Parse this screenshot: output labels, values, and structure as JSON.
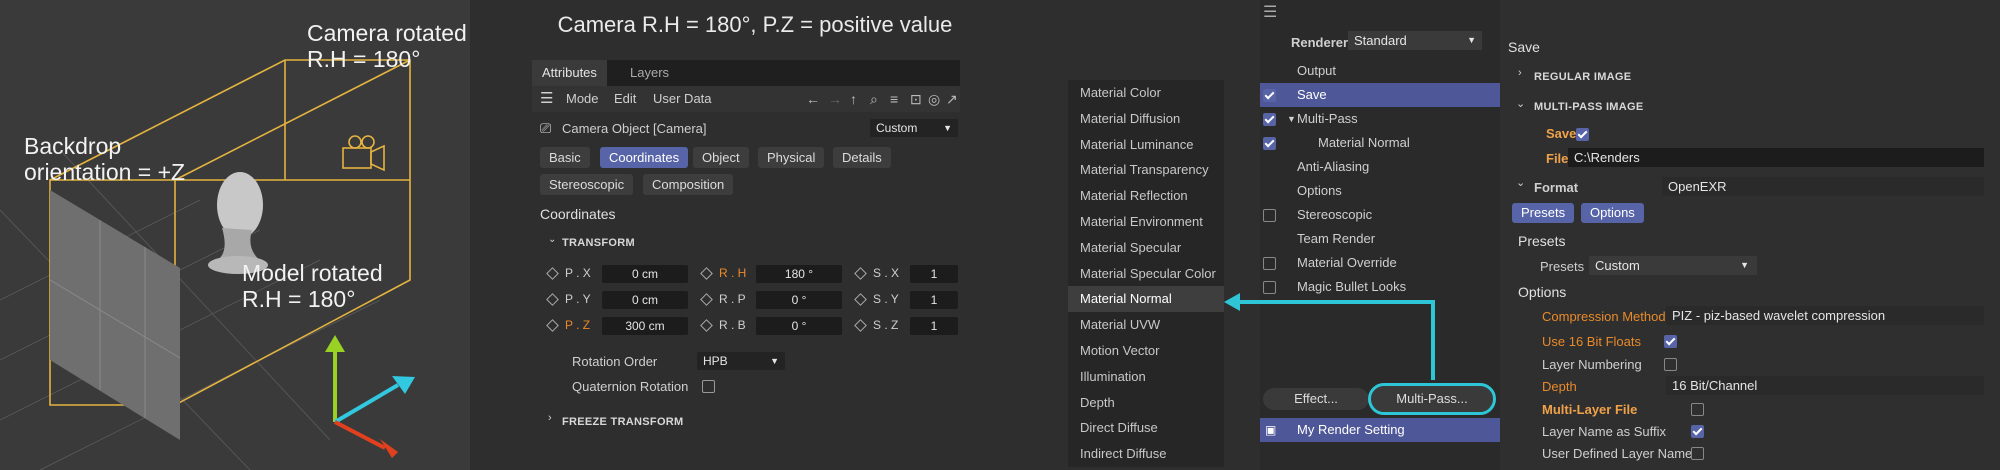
{
  "scene": {
    "camera_label_line1": "Camera rotated",
    "camera_label_line2": "R.H = 180°",
    "backdrop_label_line1": "Backdrop",
    "backdrop_label_line2": "orientation = +Z",
    "model_label_line1": "Model rotated",
    "model_label_line2": "R.H = 180°",
    "colors": {
      "wire": "#e4b340",
      "axis_y": "#9ad125",
      "axis_z": "#32c8e0",
      "axis_x": "#e0401e"
    }
  },
  "attributes": {
    "header": "Camera R.H = 180°, P.Z = positive value",
    "tabs": [
      "Attributes",
      "Layers"
    ],
    "menu": [
      "Mode",
      "Edit",
      "User Data"
    ],
    "object_name": "Camera Object [Camera]",
    "object_dropdown": "Custom",
    "property_tabs": [
      "Basic",
      "Coordinates",
      "Object",
      "Physical",
      "Details",
      "Stereoscopic",
      "Composition"
    ],
    "active_property_tab": "Coordinates",
    "section_title": "Coordinates",
    "transform_label": "TRANSFORM",
    "rows": [
      {
        "p": "P . X",
        "pv": "0 cm",
        "r": "R . H",
        "rv": "180 °",
        "s": "S . X",
        "sv": "1"
      },
      {
        "p": "P . Y",
        "pv": "0 cm",
        "r": "R . P",
        "rv": "0 °",
        "s": "S . Y",
        "sv": "1"
      },
      {
        "p": "P . Z",
        "pv": "300 cm",
        "r": "R . B",
        "rv": "0 °",
        "s": "S . Z",
        "sv": "1"
      }
    ],
    "rotation_order_label": "Rotation Order",
    "rotation_order_value": "HPB",
    "quaternion_label": "Quaternion Rotation",
    "freeze_label": "FREEZE TRANSFORM"
  },
  "passes": {
    "items": [
      "Material Color",
      "Material Diffusion",
      "Material Luminance",
      "Material Transparency",
      "Material Reflection",
      "Material Environment",
      "Material Specular",
      "Material Specular Color",
      "Material Normal",
      "Material UVW",
      "Motion Vector",
      "Illumination",
      "Depth",
      "Direct Diffuse",
      "Indirect Diffuse"
    ],
    "selected": "Material Normal",
    "arrow_color": "#2ec6d6"
  },
  "render": {
    "renderer_label": "Renderer",
    "renderer_value": "Standard",
    "tree": [
      {
        "label": "Output",
        "check": "none",
        "indent": 0
      },
      {
        "label": "Save",
        "check": "on",
        "indent": 0,
        "selected": true
      },
      {
        "label": "Multi-Pass",
        "check": "on",
        "indent": 0,
        "arrow": true
      },
      {
        "label": "Material Normal",
        "check": "on",
        "indent": 1
      },
      {
        "label": "Anti-Aliasing",
        "check": "none",
        "indent": 0
      },
      {
        "label": "Options",
        "check": "none",
        "indent": 0
      },
      {
        "label": "Stereoscopic",
        "check": "off",
        "indent": 0
      },
      {
        "label": "Team Render",
        "check": "none",
        "indent": 0
      },
      {
        "label": "Material Override",
        "check": "off",
        "indent": 0
      },
      {
        "label": "Magic Bullet Looks",
        "check": "off",
        "indent": 0
      }
    ],
    "effect_button": "Effect...",
    "multipass_button": "Multi-Pass...",
    "render_setting": "My Render Setting",
    "save_title": "Save",
    "regular_image": "REGULAR IMAGE",
    "multipass_image": "MULTI-PASS IMAGE",
    "save_label": "Save",
    "file_label": "File",
    "file_value": "C:\\Renders",
    "format_label": "Format",
    "format_value": "OpenEXR",
    "presets_btn": "Presets",
    "options_btn": "Options",
    "presets_header": "Presets",
    "presets_label": "Presets",
    "presets_value": "Custom",
    "options_header": "Options",
    "compression_label": "Compression Method",
    "compression_value": "PIZ - piz-based wavelet compression",
    "use16_label": "Use 16 Bit Floats",
    "layer_numbering_label": "Layer Numbering",
    "depth_label": "Depth",
    "depth_value": "16 Bit/Channel",
    "multilayer_label": "Multi-Layer File",
    "suffix_label": "Layer Name as Suffix",
    "userdefined_label": "User Defined Layer Name"
  }
}
